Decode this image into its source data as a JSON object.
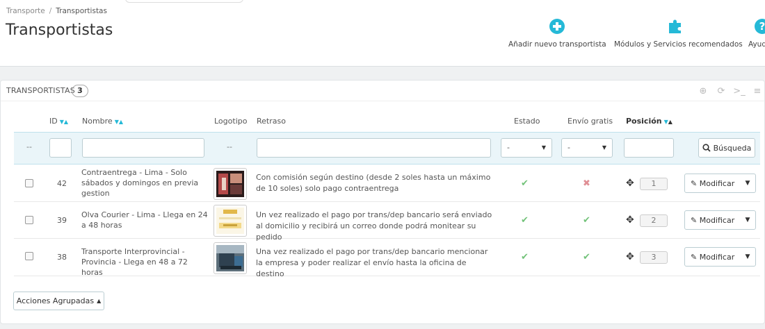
{
  "breadcrumb": {
    "parent": "Transporte",
    "separator": "/",
    "current": "Transportistas"
  },
  "page_title": "Transportistas",
  "toolbar": {
    "add_label": "Añadir nuevo transportista",
    "modules_label": "Módulos y Servicios recomendados",
    "help_label": "Ayuda"
  },
  "panel": {
    "title": "TRANSPORTISTAS",
    "count": "3"
  },
  "columns": {
    "id": "ID",
    "name": "Nombre",
    "logo": "Logotipo",
    "delay": "Retraso",
    "status": "Estado",
    "free_shipping": "Envío gratis",
    "position": "Posición"
  },
  "filters": {
    "dash": "--",
    "status_value": "-",
    "free_value": "-",
    "search_label": "Búsqueda"
  },
  "rows": [
    {
      "id": "42",
      "name": "Contraentrega - Lima - Solo sábados y domingos en previa gestion",
      "delay": "Con comisión según destino (desde 2 soles hasta un máximo de 10 soles) solo pago contraentrega",
      "status": "✔",
      "free": "✖",
      "position": "1",
      "action": "Modificar"
    },
    {
      "id": "39",
      "name": "Olva Courier - Lima - Llega en 24 a 48 horas",
      "delay": "Un vez realizado el pago por trans/dep bancario será enviado al domicilio y recibirá un correo donde podrá monitear su pedido",
      "status": "✔",
      "free": "✔",
      "position": "2",
      "action": "Modificar"
    },
    {
      "id": "38",
      "name": "Transporte Interprovincial - Provincia - Llega en 48 a 72 horas",
      "delay": "Una vez realizado el pago por trans/dep bancario mencionar la empresa y poder realizar el envío hasta la oficina de destino",
      "status": "✔",
      "free": "✔",
      "position": "3",
      "action": "Modificar"
    }
  ],
  "bulk_actions_label": "Acciones Agrupadas",
  "colors": {
    "accent": "#25b9d7",
    "ok": "#72c279",
    "no": "#e08f95"
  }
}
